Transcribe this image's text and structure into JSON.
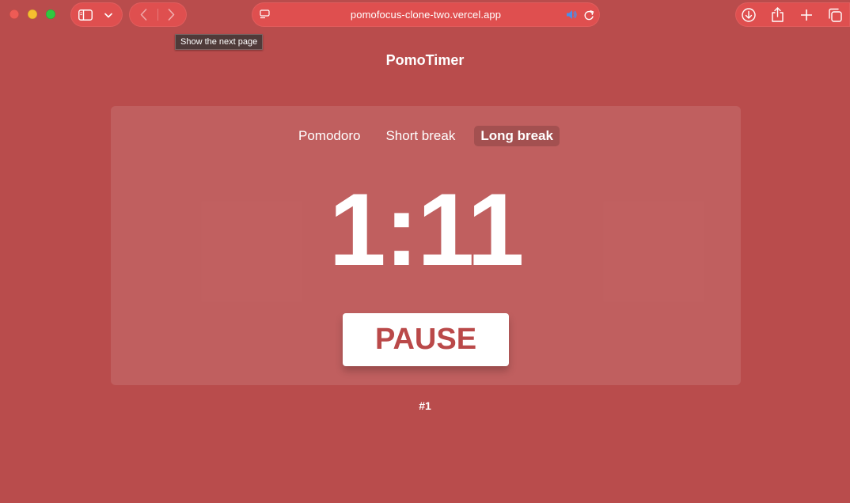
{
  "browser": {
    "url": "pomofocus-clone-two.vercel.app",
    "tooltip": "Show the next page",
    "icons": {
      "sidebar": "sidebar-icon",
      "dropdown": "chevron-down-icon",
      "back": "chevron-left-icon",
      "forward": "chevron-right-icon",
      "page_menu": "page-menu-icon",
      "audio": "speaker-icon",
      "reload": "reload-icon",
      "download": "download-icon",
      "share": "share-icon",
      "new_tab": "plus-icon",
      "tabs_overview": "tabs-icon"
    }
  },
  "app": {
    "title": "PomoTimer",
    "tabs": [
      {
        "label": "Pomodoro",
        "active": false
      },
      {
        "label": "Short break",
        "active": false
      },
      {
        "label": "Long break",
        "active": true
      }
    ],
    "timer": "1:11",
    "action_label": "PAUSE",
    "session_count": "#1"
  },
  "colors": {
    "background": "#b94c4c",
    "accent_text": "#ba4949",
    "toolbar_pill": "#df4f4f",
    "audio_icon": "#4a8fe8"
  }
}
